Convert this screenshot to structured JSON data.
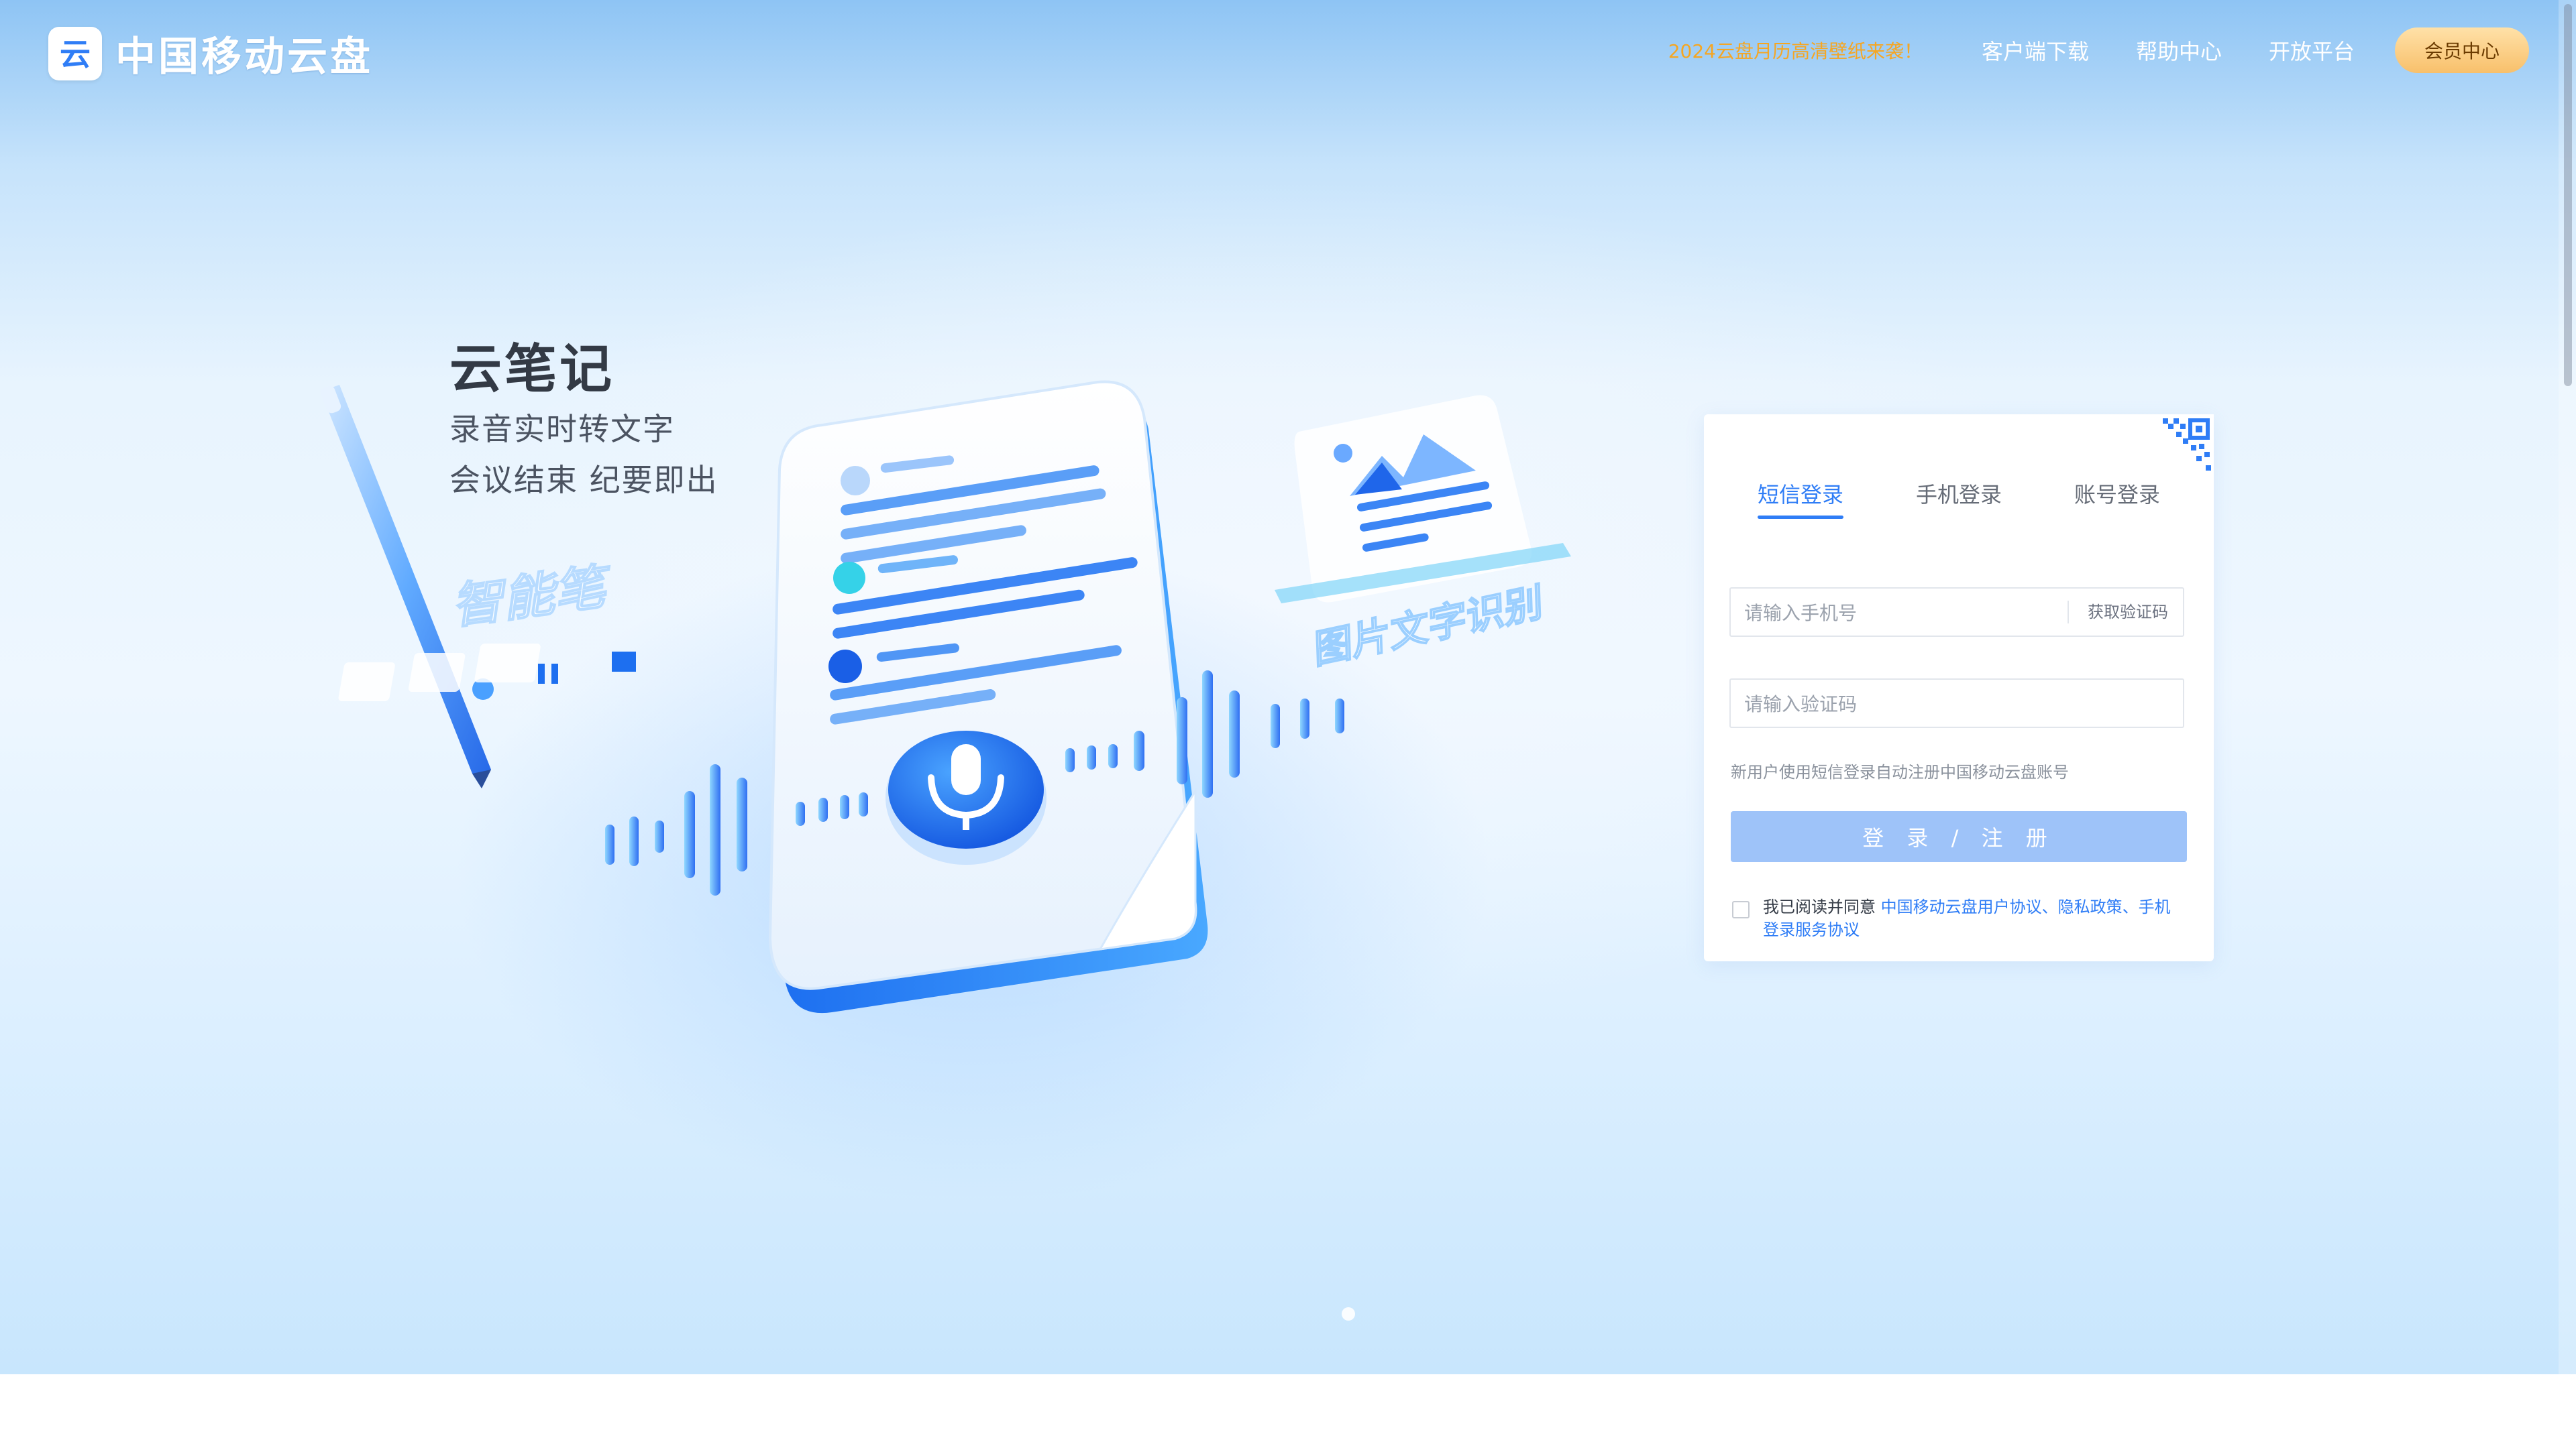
{
  "brand": {
    "name": "中国移动云盘",
    "logo_glyph": "云"
  },
  "nav": {
    "promo": "2024云盘月历高清壁纸来袭！",
    "items": [
      "客户端下载",
      "帮助中心",
      "开放平台"
    ],
    "vip": "会员中心"
  },
  "promo": {
    "title": "云笔记",
    "line1": "录音实时转文字",
    "line2": "会议结束  纪要即出",
    "pen_label": "智能笔",
    "ocr_label": "图片文字识别"
  },
  "login": {
    "tabs": [
      "短信登录",
      "手机登录",
      "账号登录"
    ],
    "active_tab": "短信登录",
    "phone_placeholder": "请输入手机号",
    "get_code": "获取验证码",
    "code_placeholder": "请输入验证码",
    "hint": "新用户使用短信登录自动注册中国移动云盘账号",
    "submit": "登 录 / 注 册",
    "agree_prefix": "我已阅读并同意 ",
    "agree_links": "中国移动云盘用户协议、隐私政策、手机登录服务协议"
  },
  "colors": {
    "accent": "#2f7df6",
    "vip_gold": "#f8c06b",
    "promo_orange": "#f5a623"
  },
  "icons": [
    "cloud-logo-icon",
    "qr-code-icon",
    "microphone-icon",
    "image-icon",
    "pen-icon"
  ]
}
